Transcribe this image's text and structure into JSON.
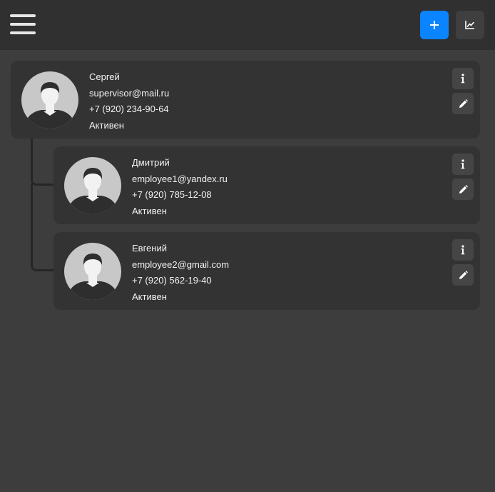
{
  "header": {
    "menu_icon": "hamburger-menu-icon",
    "add_icon": "plus-icon",
    "stats_icon": "line-chart-icon",
    "accent_color": "#0a84ff"
  },
  "employees": [
    {
      "name": "Сергей",
      "email": "supervisor@mail.ru",
      "phone": "+7 (920) 234-90-64",
      "status": "Активен"
    },
    {
      "name": "Дмитрий",
      "email": "employee1@yandex.ru",
      "phone": "+7 (920) 785-12-08",
      "status": "Активен"
    },
    {
      "name": "Евгений",
      "email": "employee2@gmail.com",
      "phone": "+7 (920) 562-19-40",
      "status": "Активен"
    }
  ],
  "card_actions": {
    "info_icon": "info-icon",
    "edit_icon": "pencil-icon"
  }
}
